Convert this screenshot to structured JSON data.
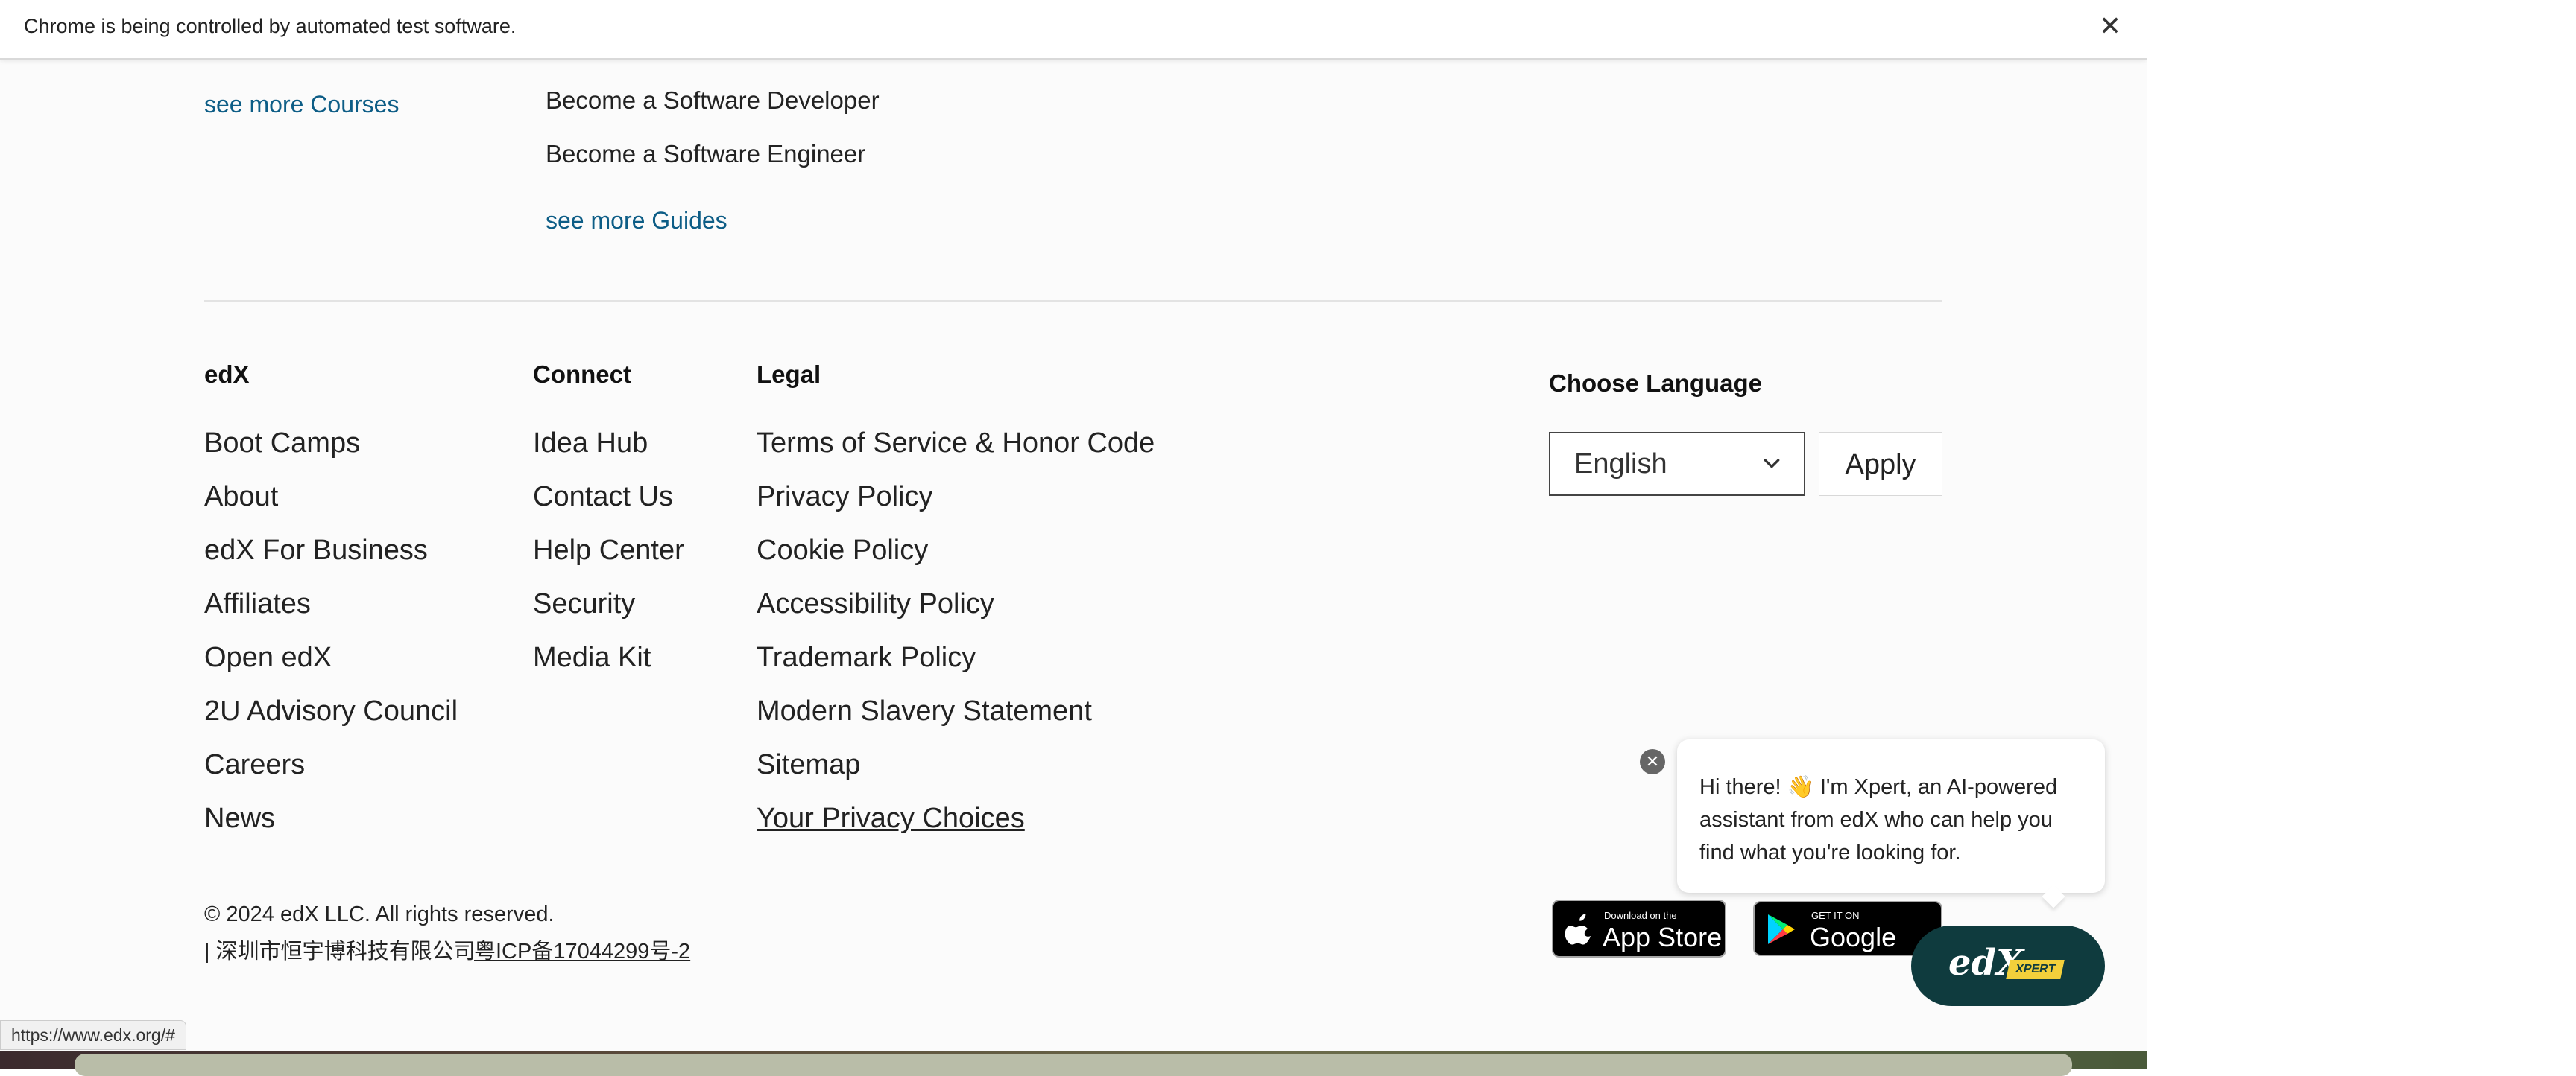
{
  "infobar": {
    "message": "Chrome is being controlled by automated test software.",
    "close_symbol": "✕"
  },
  "top": {
    "see_more_courses": "see more Courses",
    "guides": [
      "Become a Software Developer",
      "Become a Software Engineer"
    ],
    "see_more_guides": "see more Guides"
  },
  "footer": {
    "columns": [
      {
        "heading": "edX",
        "items": [
          "Boot Camps",
          "About",
          "edX For Business",
          "Affiliates",
          "Open edX",
          "2U Advisory Council",
          "Careers",
          "News"
        ]
      },
      {
        "heading": "Connect",
        "items": [
          "Idea Hub",
          "Contact Us",
          "Help Center",
          "Security",
          "Media Kit"
        ]
      },
      {
        "heading": "Legal",
        "items": [
          "Terms of Service & Honor Code",
          "Privacy Policy",
          "Cookie Policy",
          "Accessibility Policy",
          "Trademark Policy",
          "Modern Slavery Statement",
          "Sitemap",
          "Your Privacy Choices"
        ]
      }
    ],
    "language": {
      "heading": "Choose Language",
      "selected": "English",
      "apply_label": "Apply"
    },
    "copyright": "© 2024 edX LLC. All rights reserved.",
    "icp_company": "| 深圳市恒宇博科技有限公司",
    "icp_link": "粤ICP备17044299号-2",
    "app_store": {
      "small": "Download on the",
      "big": "App Store"
    },
    "google_play": {
      "small": "GET IT ON",
      "big": "Google Play"
    }
  },
  "xpert": {
    "bubble_text": "Hi there! 👋 I'm Xpert, an AI-powered assistant from edX who can help you find what you're looking for.",
    "close_symbol": "✕",
    "logo_text": "edX",
    "tag_text": "XPERT"
  },
  "status_url": "https://www.edx.org/#",
  "colors": {
    "link": "#0d5d86",
    "xpert_bg": "#0f3b3e",
    "xpert_tag": "#f2d03b"
  }
}
